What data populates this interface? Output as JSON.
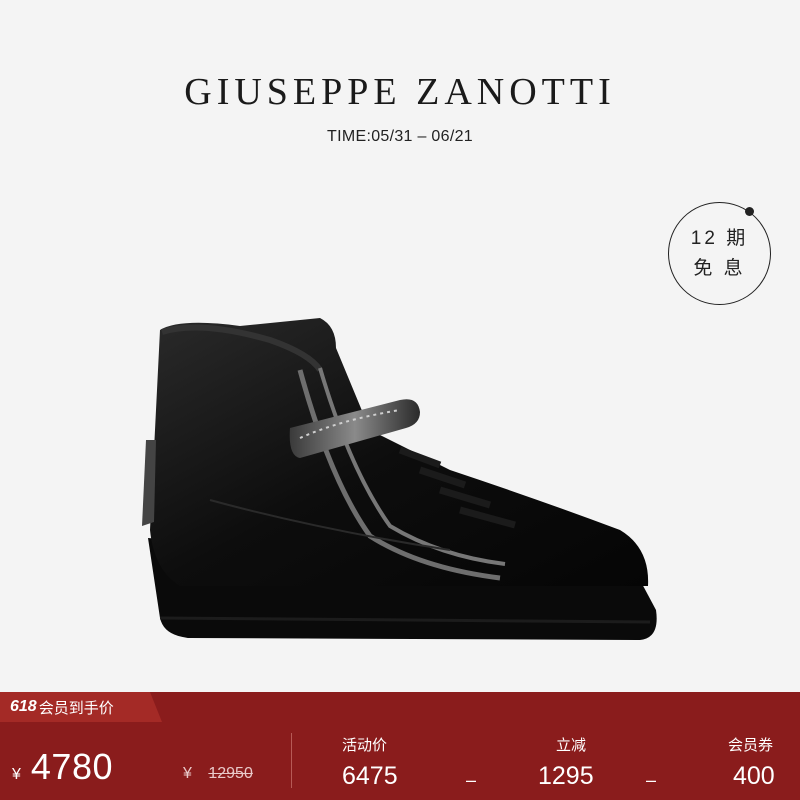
{
  "brand": {
    "name": "GIUSEPPE  ZANOTTI",
    "time": "TIME:05/31 – 06/21"
  },
  "installment": {
    "line1": "12 期",
    "line2": "免 息"
  },
  "product": {
    "name": "black-high-top-sneaker"
  },
  "price_bar": {
    "tag_num": "618",
    "tag_text": "会员到手价",
    "currency": "¥",
    "final_price": "4780",
    "orig_currency": "¥",
    "orig_price": "12950",
    "activity_label": "活动价",
    "activity_value": "6475",
    "minus1": "–",
    "instant_label": "立减",
    "instant_value": "1295",
    "minus2": "–",
    "coupon_label": "会员券",
    "coupon_value": "400"
  },
  "colors": {
    "bar": "#8a1c1c",
    "tag": "#a42a26",
    "background": "#f4f4f4"
  }
}
